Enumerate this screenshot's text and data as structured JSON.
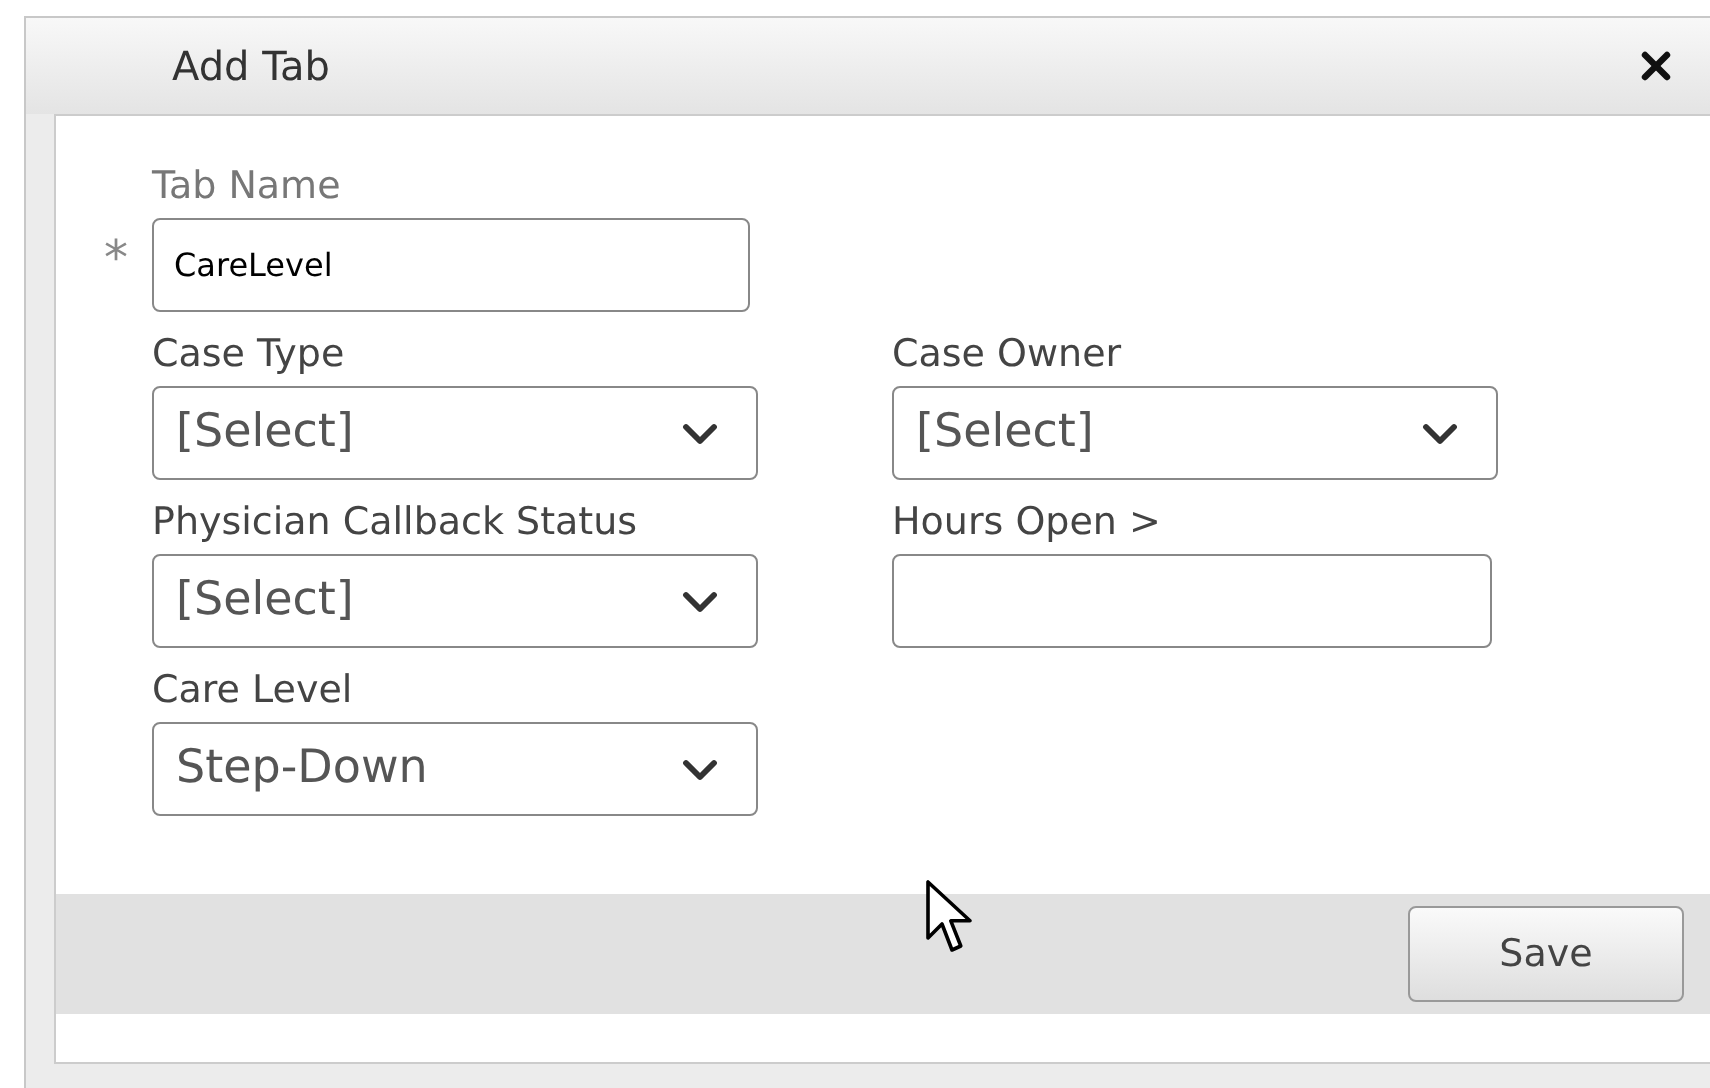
{
  "dialog": {
    "title": "Add Tab"
  },
  "rows": [
    {
      "fields": [
        {
          "kind": "text",
          "label": "Tab Name",
          "required": true,
          "required_mark": "*",
          "value": "CareLevel"
        }
      ]
    },
    {
      "fields": [
        {
          "kind": "select",
          "label": "Case Type",
          "value": "[Select]"
        },
        {
          "kind": "select",
          "label": "Case Owner",
          "value": "[Select]"
        }
      ]
    },
    {
      "fields": [
        {
          "kind": "select",
          "label": "Physician Callback Status",
          "value": "[Select]"
        },
        {
          "kind": "text",
          "label": "Hours Open >"
        }
      ]
    },
    {
      "fields": [
        {
          "kind": "select",
          "label": "Care Level",
          "value": "Step-Down"
        }
      ]
    }
  ],
  "footer": {
    "save_button": "Save"
  }
}
